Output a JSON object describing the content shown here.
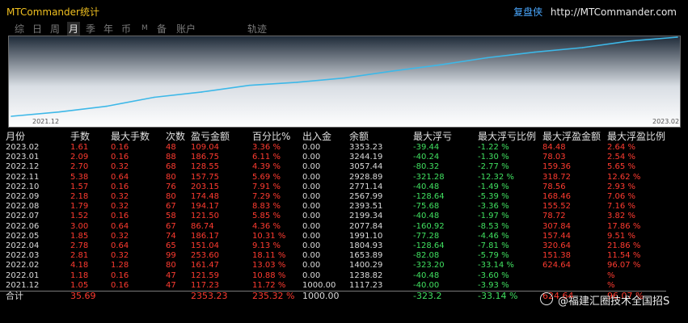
{
  "header": {
    "app_title": "MTCommander统计",
    "brand_name": "复盘侠",
    "brand_url": "http://MTCommander.com"
  },
  "tabs": [
    {
      "label": "综",
      "active": false
    },
    {
      "label": "日",
      "active": false
    },
    {
      "label": "周",
      "active": false
    },
    {
      "label": "月",
      "active": true
    },
    {
      "label": "季",
      "active": false
    },
    {
      "label": "年",
      "active": false
    },
    {
      "label": "币",
      "active": false
    },
    {
      "label": "M",
      "active": false
    },
    {
      "label": "备",
      "active": false
    },
    {
      "label": "账户",
      "active": false
    },
    {
      "label": "轨迹",
      "active": false
    }
  ],
  "chart_data": {
    "type": "line",
    "x": [
      "2021.12",
      "2022.01",
      "2022.02",
      "2022.03",
      "2022.04",
      "2022.05",
      "2022.06",
      "2022.07",
      "2022.08",
      "2022.09",
      "2022.10",
      "2022.11",
      "2022.12",
      "2023.01",
      "2023.02"
    ],
    "series": [
      {
        "values": [
          1117.23,
          1238.82,
          1400.29,
          1653.89,
          1804.93,
          1991.1,
          2077.84,
          2199.34,
          2393.51,
          2567.99,
          2771.14,
          2928.89,
          3057.44,
          3244.19,
          3353.23
        ]
      }
    ],
    "x_tick_labels": [
      "2021.12",
      "2023.02"
    ],
    "line_color": "#3db8e8",
    "grid": false
  },
  "table": {
    "columns": [
      "月份",
      "手数",
      "最大手数",
      "次数",
      "盈亏金额",
      "百分比%",
      "出入金",
      "余额",
      "最大浮亏",
      "最大浮亏比例",
      "最大浮盈金额",
      "最大浮盈比例"
    ],
    "rows": [
      [
        "2023.02",
        "1.61",
        "0.16",
        "48",
        "109.04",
        "3.36 %",
        "0.00",
        "3353.23",
        "-39.44",
        "-1.22 %",
        "84.48",
        "2.64 %"
      ],
      [
        "2023.01",
        "2.09",
        "0.16",
        "88",
        "186.75",
        "6.11 %",
        "0.00",
        "3244.19",
        "-40.24",
        "-1.30 %",
        "78.03",
        "2.54 %"
      ],
      [
        "2022.12",
        "2.70",
        "0.32",
        "68",
        "128.55",
        "4.39 %",
        "0.00",
        "3057.44",
        "-80.32",
        "-2.77 %",
        "159.36",
        "5.65 %"
      ],
      [
        "2022.11",
        "5.38",
        "0.64",
        "80",
        "157.75",
        "5.69 %",
        "0.00",
        "2928.89",
        "-321.28",
        "-12.32 %",
        "318.72",
        "12.62 %"
      ],
      [
        "2022.10",
        "1.57",
        "0.16",
        "76",
        "203.15",
        "7.91 %",
        "0.00",
        "2771.14",
        "-40.48",
        "-1.49 %",
        "78.56",
        "2.93 %"
      ],
      [
        "2022.09",
        "2.18",
        "0.32",
        "80",
        "174.48",
        "7.29 %",
        "0.00",
        "2567.99",
        "-128.64",
        "-5.39 %",
        "168.46",
        "7.06 %"
      ],
      [
        "2022.08",
        "1.79",
        "0.32",
        "67",
        "194.17",
        "8.83 %",
        "0.00",
        "2393.51",
        "-75.68",
        "-3.36 %",
        "155.52",
        "7.16 %"
      ],
      [
        "2022.07",
        "1.52",
        "0.16",
        "58",
        "121.50",
        "5.85 %",
        "0.00",
        "2199.34",
        "-40.48",
        "-1.97 %",
        "78.72",
        "3.82 %"
      ],
      [
        "2022.06",
        "3.00",
        "0.64",
        "67",
        "86.74",
        "4.36 %",
        "0.00",
        "2077.84",
        "-160.92",
        "-8.53 %",
        "307.84",
        "17.86 %"
      ],
      [
        "2022.05",
        "1.85",
        "0.32",
        "74",
        "186.17",
        "10.31 %",
        "0.00",
        "1991.10",
        "-77.28",
        "-4.46 %",
        "157.44",
        "9.51 %"
      ],
      [
        "2022.04",
        "2.78",
        "0.64",
        "65",
        "151.04",
        "9.13 %",
        "0.00",
        "1804.93",
        "-128.64",
        "-7.81 %",
        "320.64",
        "21.86 %"
      ],
      [
        "2022.03",
        "2.81",
        "0.32",
        "99",
        "253.60",
        "18.11 %",
        "0.00",
        "1653.89",
        "-82.08",
        "-5.79 %",
        "151.38",
        "11.54 %"
      ],
      [
        "2022.02",
        "4.18",
        "1.28",
        "80",
        "161.47",
        "13.03 %",
        "0.00",
        "1400.29",
        "-323.20",
        "-33.14 %",
        "624.64",
        "96.07 %"
      ],
      [
        "2022.01",
        "1.18",
        "0.16",
        "47",
        "121.59",
        "10.88 %",
        "0.00",
        "1238.82",
        "-40.48",
        "-3.60 %",
        "",
        "%"
      ],
      [
        "2021.12",
        "1.05",
        "0.16",
        "47",
        "117.23",
        "11.72 %",
        "1000.00",
        "1117.23",
        "-40.00",
        "-3.93 %",
        "",
        "%"
      ]
    ],
    "total": [
      "合计",
      "35.69",
      "",
      "",
      "2353.23",
      "235.32 %",
      "1000.00",
      "",
      "-323.2",
      "-33.14 %",
      "624.64",
      "96.07 %"
    ]
  },
  "watermark": {
    "text": "@福建汇圈技术全国招S"
  },
  "colors": {
    "background": "#000000",
    "positive": "#ff3b30",
    "negative": "#40e060",
    "title": "#f0c020",
    "brand": "#4aa8ff",
    "line": "#3db8e8"
  }
}
